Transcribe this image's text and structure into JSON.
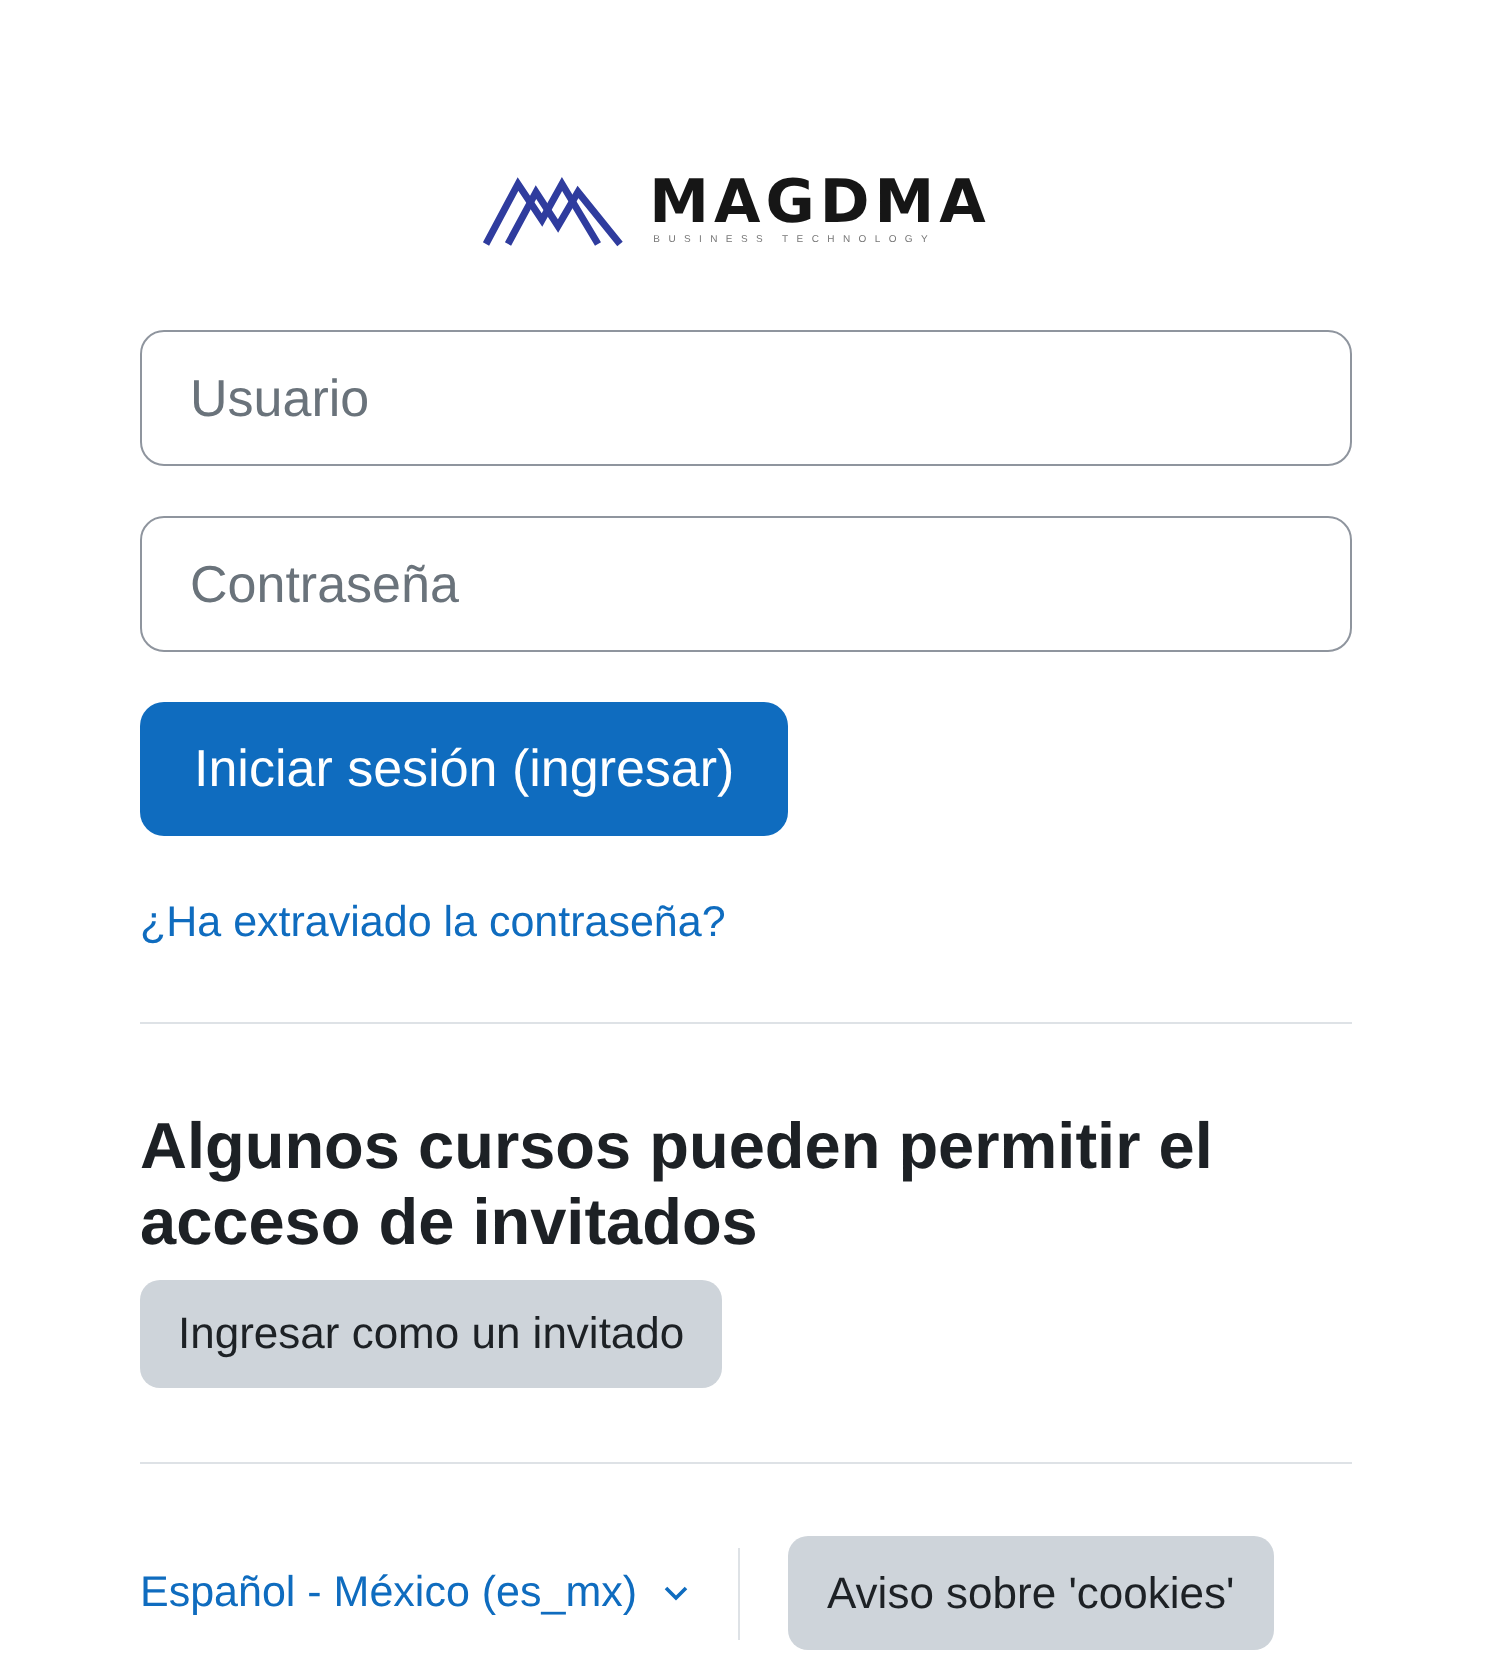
{
  "logo": {
    "name": "MAGDMA",
    "tagline": "BUSINESS TECHNOLOGY"
  },
  "fields": [
    {
      "placeholder": "Usuario"
    },
    {
      "placeholder": "Contraseña"
    }
  ],
  "login_button": "Iniciar sesión (ingresar)",
  "forgot_link": "¿Ha extraviado la contraseña?",
  "guest": {
    "heading": "Algunos cursos pueden permitir el acceso de invitados",
    "button": "Ingresar como un invitado"
  },
  "footer": {
    "language": "Español - México (es_mx)",
    "cookies_button": "Aviso sobre 'cookies'"
  }
}
